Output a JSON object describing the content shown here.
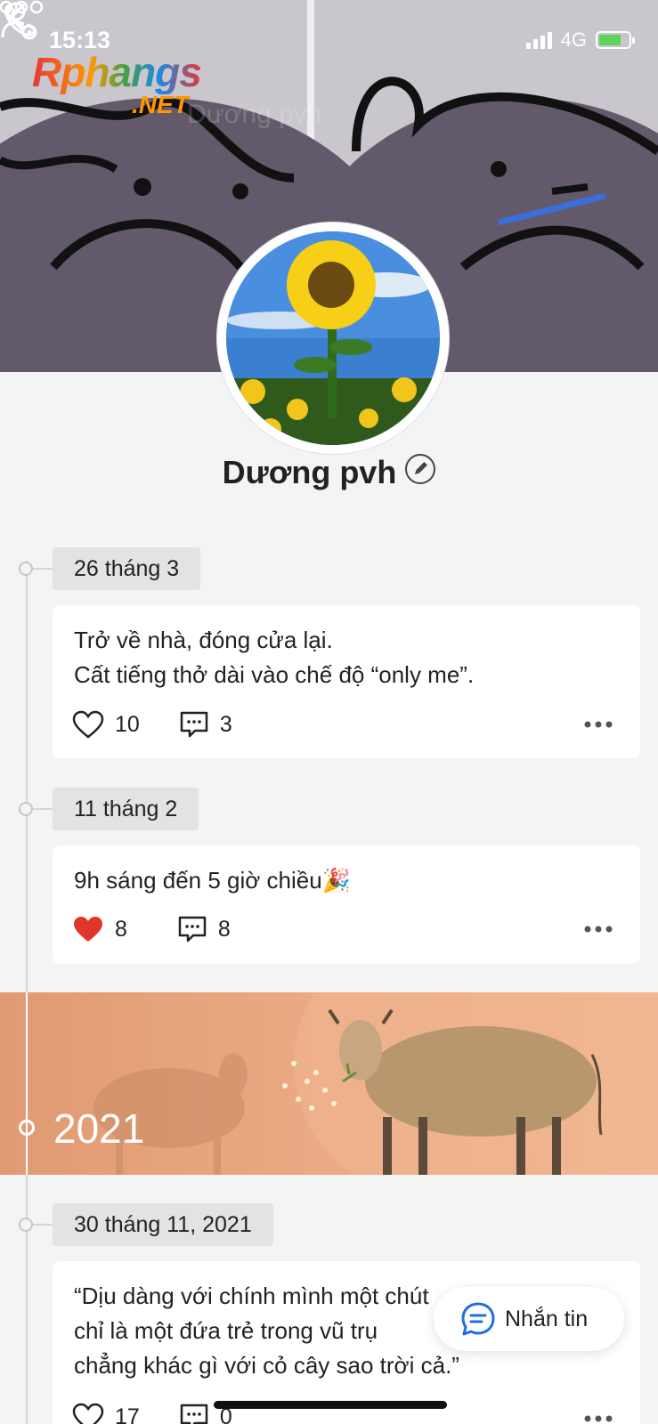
{
  "status_bar": {
    "time": "15:13",
    "network": "4G"
  },
  "watermark": {
    "line1": "Rphangs",
    "line2": ".NET"
  },
  "header": {
    "ghost_title": "Dương pvh"
  },
  "profile": {
    "name": "Dương pvh"
  },
  "year_banner": {
    "year": "2021"
  },
  "posts": [
    {
      "date": "26 tháng 3",
      "lines": [
        "Trở về nhà, đóng cửa lại.",
        "Cất tiếng thở dài vào chế độ “only me”."
      ],
      "likes": "10",
      "liked": false,
      "comments": "3"
    },
    {
      "date": "11 tháng 2",
      "lines": [
        "9h sáng đến 5 giờ chiều🎉"
      ],
      "likes": "8",
      "liked": true,
      "comments": "8"
    },
    {
      "date": "30 tháng 11, 2021",
      "lines": [
        "“Dịu dàng với chính mình một chút",
        "chỉ là một đứa trẻ trong vũ trụ",
        "chẳng khác gì với cỏ cây sao trời cả.”"
      ],
      "likes": "17",
      "liked": false,
      "comments": "0"
    }
  ],
  "fab": {
    "label": "Nhắn tin"
  },
  "colors": {
    "like_active": "#e0352b",
    "message_icon": "#1e6fe0",
    "banner": "#e9a67f"
  }
}
